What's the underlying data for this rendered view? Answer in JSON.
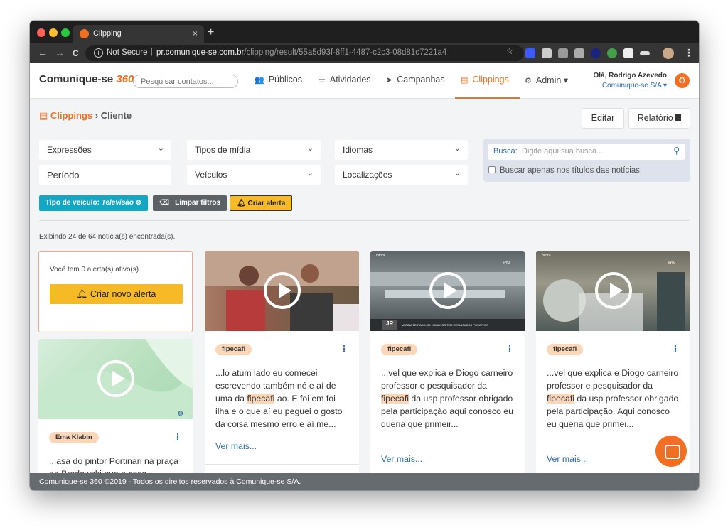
{
  "browser": {
    "tab_title": "Clipping",
    "tab_close": "×",
    "new_tab": "+",
    "not_secure": "Not Secure",
    "url_domain": "pr.comunique-se.com.br",
    "url_path": "/clipping/result/55a5d93f-8ff1-4487-c2c3-08d81c7221a4",
    "back_icon": "←",
    "forward_icon": "→",
    "reload_icon": "C"
  },
  "app": {
    "logo_text": "Comunique-se",
    "logo_number": "360",
    "search_placeholder": "Pesquisar contatos...",
    "nav": [
      {
        "icon": "users-icon",
        "glyph": "👥",
        "label": "Públicos"
      },
      {
        "icon": "checklist-icon",
        "glyph": "☰",
        "label": "Atividades"
      },
      {
        "icon": "send-icon",
        "glyph": "➤",
        "label": "Campanhas"
      },
      {
        "icon": "newspaper-icon",
        "glyph": "▤",
        "label": "Clippings"
      },
      {
        "icon": "gear-icon",
        "glyph": "⚙",
        "label": "Admin ▾"
      }
    ],
    "user_greeting": "Olá, Rodrigo Azevedo",
    "user_company": "Comunique-se S/A ▾"
  },
  "breadcrumb": {
    "section": "Clippings",
    "separator": "›",
    "current": "Cliente"
  },
  "actions": {
    "edit": "Editar",
    "report": "Relatório"
  },
  "filters": {
    "expressoes": "Expressões",
    "tipos_midia": "Tipos de mídia",
    "idiomas": "Idiomas",
    "periodo": "Período",
    "veiculos": "Veículos",
    "localizacoes": "Localizações",
    "chevron": "⌄"
  },
  "busca": {
    "label": "Busca:",
    "placeholder": "Digite aqui sua busca...",
    "titles_only": "Buscar apenas nos títulos das notícias."
  },
  "chips": {
    "active_filter_label": "Tipo de veículo:",
    "active_filter_value": "Televisão",
    "clear": "Limpar filtros",
    "create_alert": "Criar alerta"
  },
  "result_count": "Exibindo 24 de 64 notícia(s) encontrada(s).",
  "alert_card": {
    "text": "Você tem 0 alerta(s) ativo(s)",
    "button": "Criar novo alerta"
  },
  "cards": [
    {
      "tag": "fipecafi",
      "text_before": "...lo atum lado eu comecei escrevendo também né e aí de uma da ",
      "highlight": "fipecafi",
      "text_after": " ao. E foi em foi ilha e o que aí eu peguei o gosto da coisa mesmo erro e aí me...",
      "more": "Ver mais..."
    },
    {
      "tag": "fipecafi",
      "text_before": "...vel que explica e Diogo carneiro professor e pesquisador da ",
      "highlight": "fipecafi",
      "text_after": " da usp professor obrigado pela participação aqui conosco eu queria que primeir...",
      "more": "Ver mais..."
    },
    {
      "tag": "fipecafi",
      "text_before": "...vel que explica e Diogo carneiro professor e pesquisador da ",
      "highlight": "fipecafi",
      "text_after": " da usp professor obrigado pela participação. Aqui conosco eu queria que primei...",
      "more": "Ver mais..."
    },
    {
      "tag": "Ema Klabin",
      "text_before": "...asa do pintor Portinari na praça de Brodowski que a casa",
      "highlight": "",
      "text_after": "",
      "more": ""
    }
  ],
  "thumb_captions": {
    "brand": "JR",
    "news_caption": "VACINA TESTADA EM HUMANOS TEM RESULTADOS POSITIVOS",
    "channel": "RN",
    "letters": "ditora"
  },
  "footer": "Comunique-se 360 ©2019 - Todos os direitos reservados à Comunique-se S/A.",
  "colors": {
    "accent": "#f26f21",
    "link": "#2b6cb0",
    "alert": "#f6ba26",
    "teal": "#14a7c4"
  }
}
